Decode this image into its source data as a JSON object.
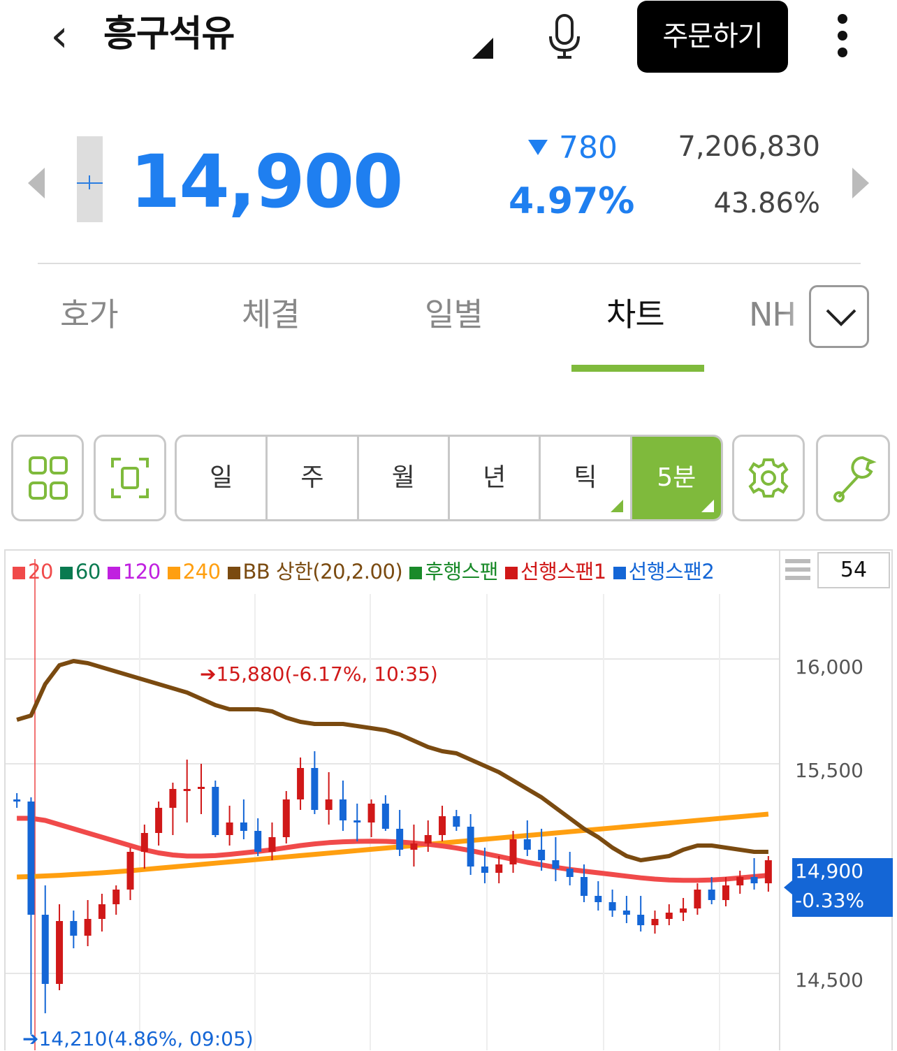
{
  "header": {
    "stock_name": "흥구석유",
    "order_label": "주문하기"
  },
  "quote": {
    "price": "14,900",
    "change": "780",
    "change_rate": "4.97%",
    "volume": "7,206,830",
    "volume_rate": "43.86%"
  },
  "tabs": [
    {
      "label": "호가",
      "active": false
    },
    {
      "label": "체결",
      "active": false
    },
    {
      "label": "일별",
      "active": false
    },
    {
      "label": "차트",
      "active": true
    },
    {
      "label": "NH",
      "active": false
    }
  ],
  "toolbar": {
    "periods": [
      {
        "label": "일",
        "active": false
      },
      {
        "label": "주",
        "active": false
      },
      {
        "label": "월",
        "active": false
      },
      {
        "label": "년",
        "active": false
      },
      {
        "label": "틱",
        "active": false
      },
      {
        "label": "5분",
        "active": true
      }
    ],
    "icons": [
      "grid-icon",
      "fullscreen-icon",
      "gear-icon",
      "wrench-icon"
    ]
  },
  "chart": {
    "candle_count": "54",
    "legend": [
      {
        "label": "20",
        "color": "#f04a4a"
      },
      {
        "label": "60",
        "color": "#0a7a50"
      },
      {
        "label": "120",
        "color": "#c020e0"
      },
      {
        "label": "240",
        "color": "#ff9f10"
      },
      {
        "label": "BB 상한(20,2.00)",
        "color": "#7a4a10"
      },
      {
        "label": "후행스팬",
        "color": "#1a8a2a"
      },
      {
        "label": "선행스팬1",
        "color": "#d01818"
      },
      {
        "label": "선행스팬2",
        "color": "#1466d6"
      }
    ],
    "y_ticks": [
      "16,000",
      "15,500",
      "14,500"
    ],
    "last_price": "14,900",
    "last_rate": "-0.33%",
    "high_marker": "15,880(-6.17%, 10:35)",
    "low_marker": "14,210(4.86%, 09:05)"
  },
  "chart_data": {
    "type": "candlestick",
    "ylim": [
      14210,
      16000
    ],
    "y_ticks": [
      14500,
      15500,
      16000
    ],
    "up_color": "#d01818",
    "down_color": "#1466d6",
    "candles": [
      [
        15330,
        15360,
        15290,
        15320
      ],
      [
        15320,
        15340,
        14210,
        14780
      ],
      [
        14780,
        14920,
        14310,
        14450
      ],
      [
        14450,
        14830,
        14420,
        14750
      ],
      [
        14750,
        14800,
        14620,
        14680
      ],
      [
        14680,
        14850,
        14630,
        14760
      ],
      [
        14760,
        14880,
        14700,
        14830
      ],
      [
        14830,
        14920,
        14780,
        14900
      ],
      [
        14900,
        15100,
        14850,
        15080
      ],
      [
        15080,
        15210,
        15000,
        15170
      ],
      [
        15170,
        15320,
        15110,
        15290
      ],
      [
        15290,
        15410,
        15160,
        15380
      ],
      [
        15380,
        15520,
        15220,
        15380
      ],
      [
        15380,
        15500,
        15260,
        15390
      ],
      [
        15390,
        15420,
        15150,
        15160
      ],
      [
        15160,
        15300,
        15110,
        15220
      ],
      [
        15220,
        15330,
        15140,
        15180
      ],
      [
        15180,
        15240,
        15060,
        15080
      ],
      [
        15080,
        15220,
        15040,
        15150
      ],
      [
        15150,
        15370,
        15120,
        15330
      ],
      [
        15330,
        15530,
        15280,
        15480
      ],
      [
        15480,
        15560,
        15260,
        15280
      ],
      [
        15280,
        15460,
        15210,
        15330
      ],
      [
        15330,
        15420,
        15180,
        15230
      ],
      [
        15230,
        15310,
        15130,
        15220
      ],
      [
        15220,
        15330,
        15150,
        15310
      ],
      [
        15310,
        15350,
        15180,
        15190
      ],
      [
        15190,
        15280,
        15060,
        15090
      ],
      [
        15090,
        15210,
        15010,
        15120
      ],
      [
        15120,
        15230,
        15080,
        15160
      ],
      [
        15160,
        15300,
        15130,
        15250
      ],
      [
        15250,
        15280,
        15180,
        15200
      ],
      [
        15200,
        15260,
        14970,
        15010
      ],
      [
        15010,
        15100,
        14930,
        14980
      ],
      [
        14980,
        15060,
        14930,
        15020
      ],
      [
        15020,
        15180,
        14980,
        15140
      ],
      [
        15140,
        15230,
        15060,
        15090
      ],
      [
        15090,
        15190,
        14990,
        15040
      ],
      [
        15040,
        15150,
        14940,
        15000
      ],
      [
        15000,
        15080,
        14920,
        14960
      ],
      [
        14960,
        15020,
        14840,
        14870
      ],
      [
        14870,
        14940,
        14800,
        14840
      ],
      [
        14840,
        14900,
        14770,
        14800
      ],
      [
        14800,
        14870,
        14740,
        14780
      ],
      [
        14780,
        14870,
        14700,
        14730
      ],
      [
        14730,
        14800,
        14690,
        14760
      ],
      [
        14760,
        14830,
        14730,
        14790
      ],
      [
        14790,
        14860,
        14750,
        14810
      ],
      [
        14810,
        14930,
        14780,
        14900
      ],
      [
        14900,
        14960,
        14830,
        14850
      ],
      [
        14850,
        14960,
        14820,
        14920
      ],
      [
        14920,
        14990,
        14880,
        14960
      ],
      [
        14960,
        15050,
        14900,
        14930
      ],
      [
        14930,
        15060,
        14890,
        15040
      ]
    ],
    "series": {
      "ma20": [
        15240,
        15240,
        15230,
        15210,
        15190,
        15170,
        15150,
        15130,
        15110,
        15090,
        15075,
        15065,
        15060,
        15060,
        15062,
        15068,
        15075,
        15082,
        15090,
        15100,
        15110,
        15118,
        15124,
        15128,
        15130,
        15131,
        15130,
        15127,
        15122,
        15116,
        15108,
        15098,
        15086,
        15072,
        15058,
        15044,
        15030,
        15018,
        15006,
        14996,
        14988,
        14980,
        14972,
        14964,
        14956,
        14950,
        14946,
        14944,
        14944,
        14946,
        14950,
        14956,
        14962,
        14968
      ],
      "ma240": [
        14960,
        14962,
        14965,
        14968,
        14972,
        14976,
        14980,
        14985,
        14990,
        14996,
        15002,
        15008,
        15014,
        15020,
        15026,
        15032,
        15038,
        15044,
        15050,
        15056,
        15062,
        15068,
        15074,
        15080,
        15086,
        15092,
        15098,
        15104,
        15110,
        15116,
        15122,
        15128,
        15134,
        15140,
        15146,
        15152,
        15158,
        15164,
        15170,
        15176,
        15182,
        15188,
        15194,
        15200,
        15206,
        15212,
        15218,
        15224,
        15230,
        15236,
        15242,
        15248,
        15254,
        15260
      ],
      "bb_upper": [
        15710,
        15730,
        15880,
        15970,
        15990,
        15980,
        15960,
        15940,
        15920,
        15900,
        15880,
        15860,
        15840,
        15810,
        15780,
        15760,
        15760,
        15760,
        15750,
        15720,
        15700,
        15690,
        15690,
        15690,
        15680,
        15670,
        15660,
        15640,
        15610,
        15580,
        15560,
        15550,
        15520,
        15490,
        15460,
        15420,
        15380,
        15340,
        15290,
        15240,
        15190,
        15150,
        15100,
        15060,
        15040,
        15050,
        15060,
        15090,
        15110,
        15110,
        15100,
        15090,
        15080,
        15080
      ]
    }
  }
}
